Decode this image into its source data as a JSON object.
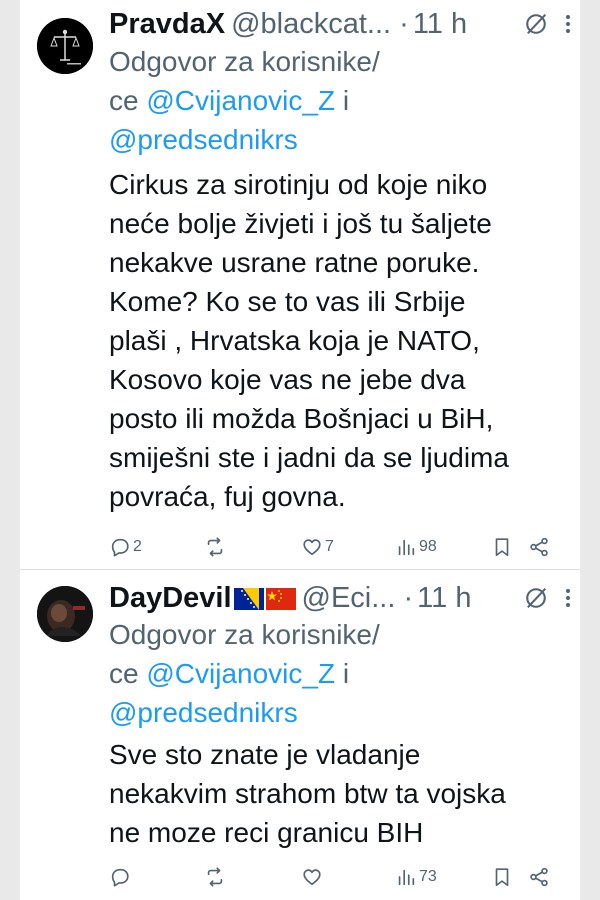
{
  "tweets": [
    {
      "display_name": "PravdaX",
      "handle": "@blackcat...",
      "time": "11 h",
      "reply_prefix": "Odgovor za korisnike/",
      "reply_line2_prefix": "ce ",
      "mention_1": "@Cvijanovic_Z",
      "reply_and": " i",
      "mention_2": "@predsednikrs",
      "text_lines": [
        "Cirkus za sirotinju od koje niko",
        "neće bolje živjeti i još tu šaljete",
        "nekakve usrane ratne poruke.",
        "Kome? Ko se to vas ili Srbije",
        "plaši , Hrvatska koja je NATO,",
        "Kosovo koje vas ne jebe dva",
        "posto ili možda Bošnjaci u BiH,",
        "smiješni ste i jadni da se ljudima",
        "povraća, fuj govna."
      ],
      "replies": "2",
      "reposts": "",
      "likes": "7",
      "views": "98",
      "avatar_icon": "scales-of-justice-avatar"
    },
    {
      "display_name": "DayDevil",
      "flags": [
        "bosnia-flag",
        "china-flag"
      ],
      "handle": "@Eci...",
      "time": "11 h",
      "reply_prefix": "Odgovor za korisnike/",
      "reply_line2_prefix": "ce ",
      "mention_1": "@Cvijanovic_Z",
      "reply_and": " i",
      "mention_2": "@predsednikrs",
      "text_lines": [
        "Sve sto znate je vladanje",
        "nekakvim strahom btw ta vojska",
        "ne moze reci granicu  BIH"
      ],
      "replies": "",
      "reposts": "",
      "likes": "",
      "views": "73",
      "avatar_icon": "dark-figure-avatar"
    }
  ],
  "colors": {
    "text": "#0f1419",
    "secondary": "#536471",
    "link": "#1d9bf0",
    "side_bar": "#e9e9e9"
  },
  "separator": "·"
}
